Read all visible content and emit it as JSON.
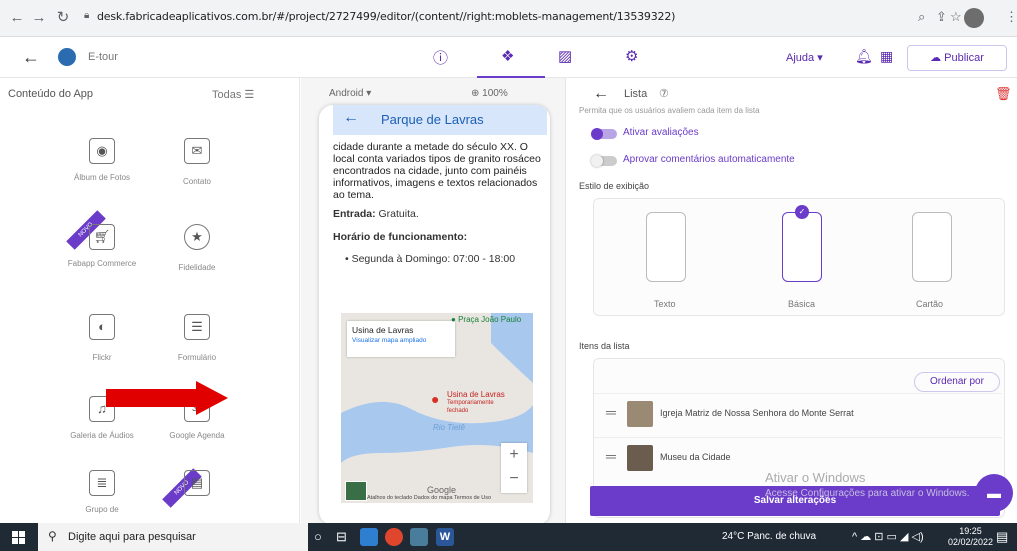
{
  "browser": {
    "url": "desk.fabricadeaplicativos.com.br/#/project/2727499/editor/(content//right:moblets-management/13539322)"
  },
  "header": {
    "app_name": "E-tour",
    "help_label": "Ajuda ▾",
    "publish_label": "Publicar"
  },
  "left_panel": {
    "title": "Conteúdo do App",
    "filter_label": "Todas",
    "novo_badge": "NOVO",
    "tiles": [
      {
        "label": "Álbum de Fotos"
      },
      {
        "label": "Contato"
      },
      {
        "label": "Fabapp Commerce"
      },
      {
        "label": "Fidelidade"
      },
      {
        "label": "Flickr"
      },
      {
        "label": "Formulário"
      },
      {
        "label": "Galeria de Áudios"
      },
      {
        "label": "Google Agenda"
      },
      {
        "label": "Grupo de"
      }
    ]
  },
  "preview": {
    "platform": "Android ▾",
    "zoom": "100%",
    "title": "Parque de Lavras",
    "text": "cidade durante a metade do século XX. O local conta variados tipos de granito rosáceo encontrados na cidade, junto com painéis informativos, imagens e textos relacionados ao tema.",
    "entrada_label": "Entrada:",
    "entrada_value": "Gratuita.",
    "horario_label": "Horário de funcionamento:",
    "schedule": "Segunda à Domingo: 07:00 - 18:00",
    "map": {
      "place": "Usina de Lavras",
      "link": "Visualizar mapa ampliado",
      "praca": "Praça João Paulo",
      "usina_label": "Usina de Lavras",
      "usina_status1": "Temporariamente",
      "usina_status2": "fechado",
      "river": "Rio Tietê",
      "google": "Google",
      "footer": "Atalhos do teclado   Dados do mapa   Termos de Uso"
    }
  },
  "right_panel": {
    "title": "Lista",
    "cut_text": "Permita que os usuários avaliem cada item da lista",
    "toggle1_label": "Ativar avaliações",
    "toggle1_on": true,
    "toggle2_label": "Aprovar comentários automaticamente",
    "toggle2_on": false,
    "style_heading": "Estilo de exibição",
    "styles": [
      {
        "label": "Texto"
      },
      {
        "label": "Básica",
        "selected": true
      },
      {
        "label": "Cartão"
      }
    ],
    "items_heading": "Itens da lista",
    "order_button": "Ordenar por",
    "items": [
      {
        "title": "Igreja Matriz de Nossa Senhora do Monte Serrat"
      },
      {
        "title": "Museu da Cidade"
      }
    ],
    "save_button": "Salvar alterações",
    "watermark_title": "Ativar o Windows",
    "watermark_sub": "Acesse Configurações para ativar o Windows."
  },
  "taskbar": {
    "search_placeholder": "Digite aqui para pesquisar",
    "weather": "24°C  Panc. de chuva",
    "time": "19:25",
    "date": "02/02/2022"
  },
  "colors": {
    "accent": "#6a3cc9",
    "preview_header": "#d7e6fb",
    "arrow": "#e00000"
  }
}
